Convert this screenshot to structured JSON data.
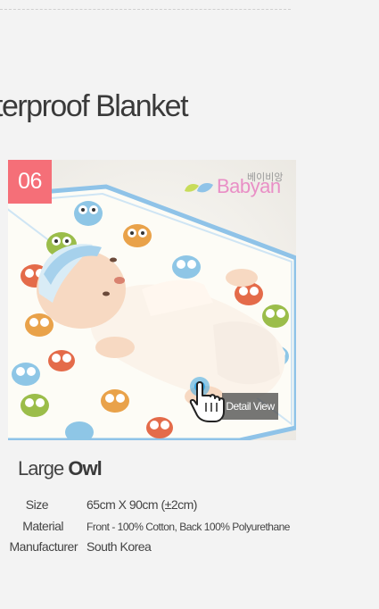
{
  "heading": "terproof Blanket",
  "badge": "06",
  "brand": {
    "korean": "베이비앙",
    "name": "Babyan"
  },
  "detail_view": {
    "label": "Detail View"
  },
  "product": {
    "title_light": "Large",
    "title_bold": "Owl"
  },
  "specs": [
    {
      "label": "Size",
      "value": "65cm X 90cm (±2cm)"
    },
    {
      "label": "Material",
      "value": "Front - 100% Cotton, Back 100% Polyurethane"
    },
    {
      "label": "Manufacturer",
      "value": "South Korea"
    }
  ],
  "colors": {
    "badge": "#f56f78",
    "brand": "#e98fc6",
    "blanket_edge": "#8fc3e8"
  },
  "icons": {
    "hand": "hand-pointer-icon",
    "leaf": "leaf-icon"
  }
}
